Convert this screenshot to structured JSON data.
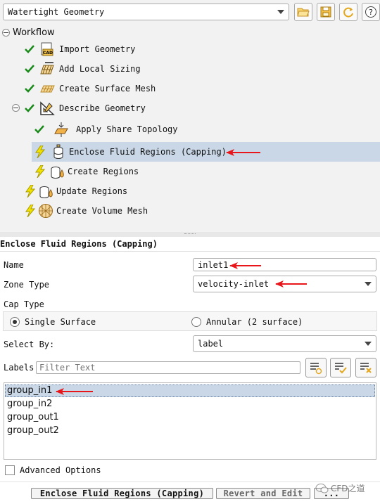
{
  "toolbar": {
    "workflow_select": "Watertight Geometry",
    "icons": [
      "folder-open-icon",
      "save-icon",
      "refresh-icon",
      "help-icon"
    ],
    "help_glyph": "?"
  },
  "tree": {
    "root_label": "Workflow",
    "items": [
      {
        "label": "Import Geometry",
        "status": "done"
      },
      {
        "label": "Add Local Sizing",
        "status": "done"
      },
      {
        "label": "Create Surface Mesh",
        "status": "done"
      },
      {
        "label": "Describe Geometry",
        "status": "done"
      },
      {
        "label": "Apply Share Topology",
        "status": "done"
      },
      {
        "label": "Enclose Fluid Regions (Capping)",
        "status": "pending",
        "selected": true
      },
      {
        "label": "Create Regions",
        "status": "pending"
      },
      {
        "label": "Update Regions",
        "status": "pending"
      },
      {
        "label": "Create Volume Mesh",
        "status": "pending"
      }
    ]
  },
  "panel": {
    "title": "Enclose Fluid Regions (Capping)",
    "name_label": "Name",
    "name_value": "inlet1",
    "zone_type_label": "Zone Type",
    "zone_type_value": "velocity-inlet",
    "cap_type_label": "Cap Type",
    "cap_single": "Single Surface",
    "cap_annular": "Annular (2 surface)",
    "cap_selected": "Single Surface",
    "select_by_label": "Select By:",
    "select_by_value": "label",
    "labels_label": "Labels",
    "filter_placeholder": "Filter Text",
    "list_items": [
      "group_in1",
      "group_in2",
      "group_out1",
      "group_out2"
    ],
    "selected_item": "group_in1",
    "advanced_label": "Advanced Options",
    "advanced_checked": false
  },
  "footer": {
    "primary_button": "Enclose Fluid Regions (Capping)",
    "revert_button": "Revert and Edit",
    "more_button": "...",
    "watermark": "CFD之道"
  },
  "colors": {
    "selected_row": "#c9d7e6",
    "check_green": "#1a8a1a",
    "bolt_yellow": "#f2e200",
    "annotation_red": "#e8161b"
  }
}
